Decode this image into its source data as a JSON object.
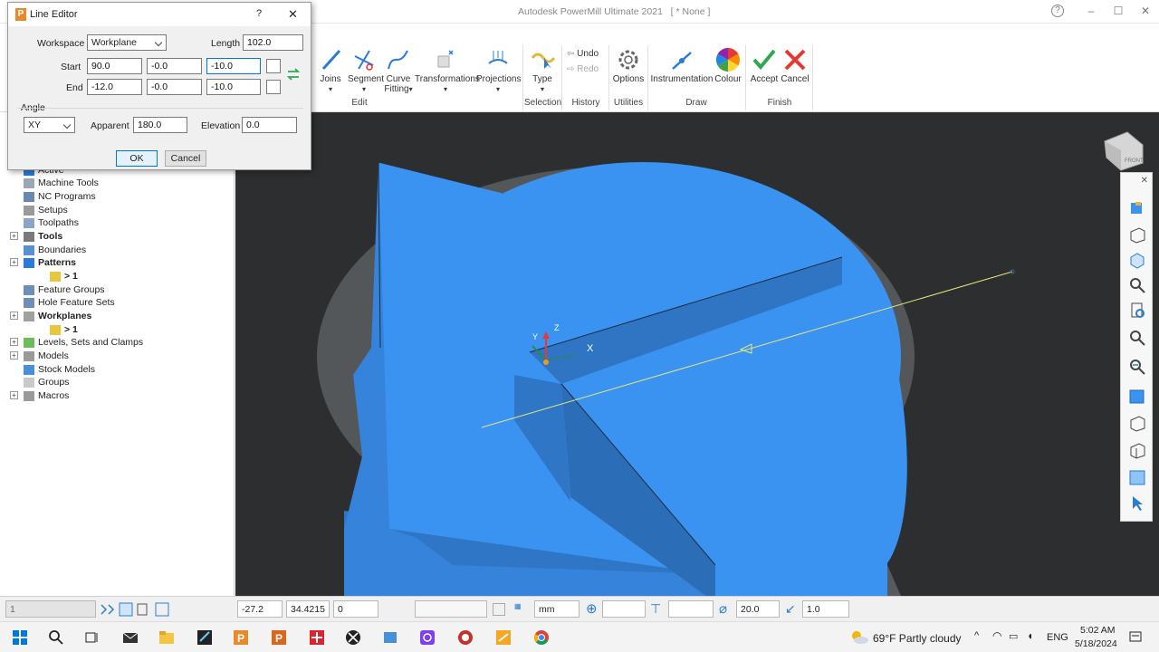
{
  "app": {
    "title": "Autodesk PowerMill Ultimate 2021",
    "doc": "[ * None ]",
    "help_icon": "?"
  },
  "ribbon": {
    "buttons": {
      "joins": "Joins",
      "segment": "Segment",
      "curve": "Curve",
      "curve2": "Fitting",
      "transformations": "Transformations",
      "projections": "Projections",
      "type": "Type",
      "undo": "Undo",
      "redo": "Redo",
      "options": "Options",
      "instrumentation": "Instrumentation",
      "colour": "Colour",
      "accept": "Accept",
      "cancel": "Cancel"
    },
    "groups": {
      "edit": "Edit",
      "selection": "Selection",
      "history": "History",
      "utilities": "Utilities",
      "draw": "Draw",
      "finish": "Finish"
    }
  },
  "dialog": {
    "title": "Line Editor",
    "help": "?",
    "workspace_label": "Workspace",
    "workspace_value": "Workplane",
    "length_label": "Length",
    "length_value": "102.0",
    "start_label": "Start",
    "start": [
      "90.0",
      "-0.0",
      "-10.0"
    ],
    "end_label": "End",
    "end": [
      "-12.0",
      "-0.0",
      "-10.0"
    ],
    "angle_group": "Angle",
    "angle_plane": "XY",
    "apparent_label": "Apparent",
    "apparent_value": "180.0",
    "elevation_label": "Elevation",
    "elevation_value": "0.0",
    "ok": "OK",
    "cancel": "Cancel"
  },
  "tree": {
    "items": [
      {
        "label": "Active",
        "bold": false
      },
      {
        "label": "Machine Tools",
        "bold": false
      },
      {
        "label": "NC Programs",
        "bold": false
      },
      {
        "label": "Setups",
        "bold": false
      },
      {
        "label": "Toolpaths",
        "bold": false
      },
      {
        "label": "Tools",
        "bold": true
      },
      {
        "label": "Boundaries",
        "bold": false
      },
      {
        "label": "Patterns",
        "bold": true
      },
      {
        "label": "> 1",
        "bold": true
      },
      {
        "label": "Feature Groups",
        "bold": false
      },
      {
        "label": "Hole Feature Sets",
        "bold": false
      },
      {
        "label": "Workplanes",
        "bold": true
      },
      {
        "label": "> 1",
        "bold": true
      },
      {
        "label": "Levels, Sets and Clamps",
        "bold": false
      },
      {
        "label": "Models",
        "bold": false
      },
      {
        "label": "Stock Models",
        "bold": false
      },
      {
        "label": "Groups",
        "bold": false
      },
      {
        "label": "Macros",
        "bold": false
      }
    ]
  },
  "viewport": {
    "axis_x": "X",
    "axis_y": "Y",
    "axis_z": "Z",
    "viewcube_label": "FRONT"
  },
  "status": {
    "layer": "1",
    "x": "-27.2",
    "y": "34.4215",
    "z": "0",
    "units": "mm",
    "diameter": "20.0",
    "tolerance": "1.0"
  },
  "taskbar": {
    "weather": "69°F  Partly cloudy",
    "lang": "ENG",
    "time": "5:02 AM",
    "date": "5/18/2024"
  },
  "colors": {
    "part_blue": "#3a93f0",
    "viewport_bg": "#2c2e2f",
    "accent": "#0078d7"
  }
}
